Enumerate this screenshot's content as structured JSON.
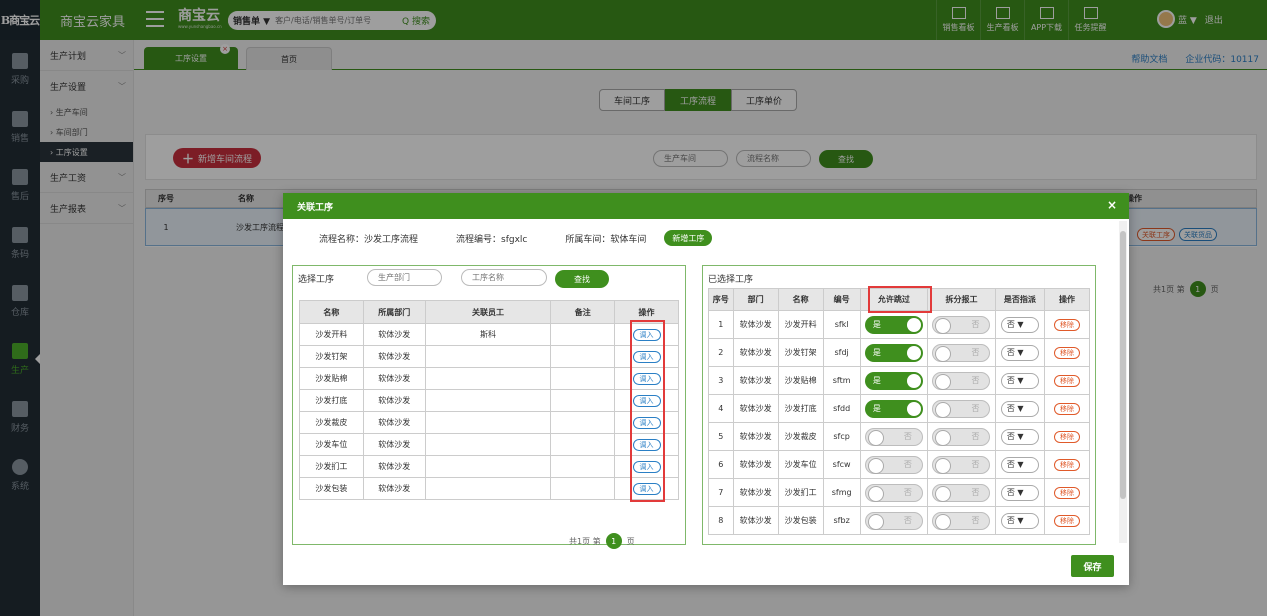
{
  "topbar": {
    "logo_text": "B商宝云",
    "app_title": "商宝云家具",
    "brand": "商宝云",
    "brand_sub": "www.yunshangbao.cn",
    "search_type": "销售单 ▼",
    "search_placeholder": "客户/电话/销售单号/订单号",
    "search_button": "Q 搜索",
    "nav": [
      "销售看板",
      "生产看板",
      "APP下载",
      "任务提醒"
    ],
    "user_name": "蓝 ▼",
    "logout": "退出"
  },
  "iconbar": {
    "items": [
      {
        "label": "采购",
        "icon": "cart-icon"
      },
      {
        "label": "销售",
        "icon": "sales-icon"
      },
      {
        "label": "售后",
        "icon": "aftersale-icon"
      },
      {
        "label": "条码",
        "icon": "barcode-icon"
      },
      {
        "label": "仓库",
        "icon": "warehouse-icon"
      },
      {
        "label": "生产",
        "icon": "production-icon"
      },
      {
        "label": "财务",
        "icon": "finance-icon"
      },
      {
        "label": "系统",
        "icon": "gear-icon"
      }
    ]
  },
  "menu": {
    "g1": "生产计划",
    "g2": "生产设置",
    "sub1": "› 生产车间",
    "sub2": "› 车间部门",
    "sub3": "› 工序设置",
    "g3": "生产工资",
    "g4": "生产报表"
  },
  "tabs": {
    "active": "工序设置",
    "close": "×",
    "home": "首页",
    "help": "帮助文档",
    "company": "企业代码：10117"
  },
  "segment": [
    "车间工序",
    "工序流程",
    "工序单价"
  ],
  "toolbar": {
    "add": "新增车间流程",
    "workshop_placeholder": "生产车间",
    "flow_placeholder": "流程名称",
    "search": "查找"
  },
  "bgtable": {
    "h_no": "序号",
    "h_name": "名称",
    "h_op": "操作",
    "row_no": "1",
    "row_name": "沙发工序流程",
    "tag1": "关联工序",
    "tag2": "关联货品",
    "pager_total": "共1页 第",
    "pager_page": "1",
    "pager_unit": "页"
  },
  "modal": {
    "title": "关联工序",
    "close": "×",
    "flow_name": "流程名称：沙发工序流程",
    "flow_code": "流程编号：sfgxlc",
    "workshop": "所属车间：软体车间",
    "new_btn": "新增工序",
    "save": "保存"
  },
  "left_panel": {
    "title": "选择工序",
    "dept_placeholder": "生产部门",
    "name_placeholder": "工序名称",
    "search": "查找",
    "headers": [
      "名称",
      "所属部门",
      "关联员工",
      "备注",
      "操作"
    ],
    "action": "调入",
    "rows": [
      {
        "name": "沙发开料",
        "dept": "软体沙发",
        "staff": "斯科",
        "note": ""
      },
      {
        "name": "沙发钉架",
        "dept": "软体沙发",
        "staff": "",
        "note": ""
      },
      {
        "name": "沙发贴棉",
        "dept": "软体沙发",
        "staff": "",
        "note": ""
      },
      {
        "name": "沙发打底",
        "dept": "软体沙发",
        "staff": "",
        "note": ""
      },
      {
        "name": "沙发裁皮",
        "dept": "软体沙发",
        "staff": "",
        "note": ""
      },
      {
        "name": "沙发车位",
        "dept": "软体沙发",
        "staff": "",
        "note": ""
      },
      {
        "name": "沙发扪工",
        "dept": "软体沙发",
        "staff": "",
        "note": ""
      },
      {
        "name": "沙发包装",
        "dept": "软体沙发",
        "staff": "",
        "note": ""
      }
    ],
    "pager_total": "共1页 第",
    "pager_page": "1",
    "pager_unit": "页"
  },
  "right_panel": {
    "title": "已选择工序",
    "headers": [
      "序号",
      "部门",
      "名称",
      "编号",
      "允许跳过",
      "拆分报工",
      "是否指派",
      "操作"
    ],
    "yes": "是",
    "no": "否",
    "select_value": "否 ▼",
    "remove": "移除",
    "rows": [
      {
        "no": "1",
        "dept": "软体沙发",
        "name": "沙发开料",
        "code": "sfkl",
        "skip": true
      },
      {
        "no": "2",
        "dept": "软体沙发",
        "name": "沙发钉架",
        "code": "sfdj",
        "skip": true
      },
      {
        "no": "3",
        "dept": "软体沙发",
        "name": "沙发贴棉",
        "code": "sftm",
        "skip": true
      },
      {
        "no": "4",
        "dept": "软体沙发",
        "name": "沙发打底",
        "code": "sfdd",
        "skip": true
      },
      {
        "no": "5",
        "dept": "软体沙发",
        "name": "沙发裁皮",
        "code": "sfcp",
        "skip": false
      },
      {
        "no": "6",
        "dept": "软体沙发",
        "name": "沙发车位",
        "code": "sfcw",
        "skip": false
      },
      {
        "no": "7",
        "dept": "软体沙发",
        "name": "沙发扪工",
        "code": "sfmg",
        "skip": false
      },
      {
        "no": "8",
        "dept": "软体沙发",
        "name": "沙发包装",
        "code": "sfbz",
        "skip": false
      }
    ]
  }
}
